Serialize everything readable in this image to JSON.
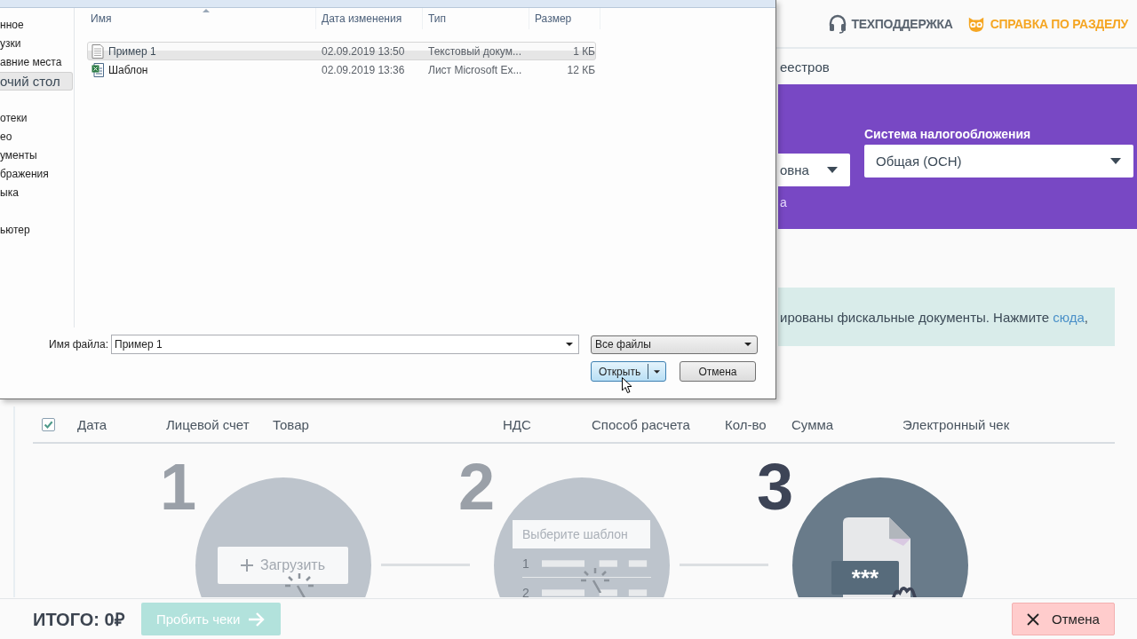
{
  "header": {
    "support": "ТЕХПОДДЕРЖКА",
    "help": "СПРАВКА ПО РАЗДЕЛУ"
  },
  "tab_fragment": "еестров",
  "settings": {
    "left_select_value": "овна",
    "left_link": "а",
    "tax_label": "Система налогообложения",
    "tax_value": "Общая (ОСН)"
  },
  "notice": {
    "text": "ированы фискальные документы. Нажмите ",
    "link": "сюда",
    "tail": ","
  },
  "table": {
    "select_all_checked": true,
    "columns": [
      "Дата",
      "Лицевой счет",
      "Товар",
      "НДС",
      "Способ расчета",
      "Кол-во",
      "Сумма",
      "Электронный чек"
    ]
  },
  "steps": [
    {
      "number": "1",
      "active": false,
      "kind": "upload",
      "button": "Загрузить"
    },
    {
      "number": "2",
      "active": false,
      "kind": "template",
      "placeholder": "Выберите шаблон",
      "rows": [
        "1",
        "2"
      ]
    },
    {
      "number": "3",
      "active": true,
      "kind": "receipt",
      "code": "***"
    }
  ],
  "footer": {
    "total": "ИТОГО: 0₽",
    "submit": "Пробить чеки",
    "submit_disabled": true,
    "cancel": "Отмена"
  },
  "dialog": {
    "nav_groups": [
      {
        "children": [
          {
            "label": "нное",
            "selected": false
          },
          {
            "label": "узки",
            "selected": false
          },
          {
            "label": "авние места",
            "selected": false
          },
          {
            "label": "очий стол",
            "selected": true
          }
        ]
      },
      {
        "children": [
          {
            "label": "отеки",
            "selected": false
          },
          {
            "label": "ео",
            "selected": false
          },
          {
            "label": "ументы",
            "selected": false
          },
          {
            "label": "бражения",
            "selected": false
          },
          {
            "label": "ыка",
            "selected": false
          }
        ]
      },
      {
        "children": [
          {
            "label": "ьютер",
            "selected": false
          }
        ]
      }
    ],
    "columns": [
      {
        "label": "Имя",
        "sorted": true
      },
      {
        "label": "Дата изменения",
        "sorted": false
      },
      {
        "label": "Тип",
        "sorted": false
      },
      {
        "label": "Размер",
        "sorted": false
      }
    ],
    "files": [
      {
        "name": "Пример 1",
        "kind": "text",
        "modified": "02.09.2019 13:50",
        "type": "Текстовый докум...",
        "size": "1 КБ",
        "selected": true
      },
      {
        "name": "Шаблон",
        "kind": "excel",
        "modified": "02.09.2019 13:36",
        "type": "Лист Microsoft Ex...",
        "size": "12 КБ",
        "selected": false
      }
    ],
    "file_name_label": "Имя файла:",
    "file_name": "Пример 1",
    "file_type": "Все файлы",
    "open_button": "Открыть",
    "cancel_button": "Отмена"
  }
}
